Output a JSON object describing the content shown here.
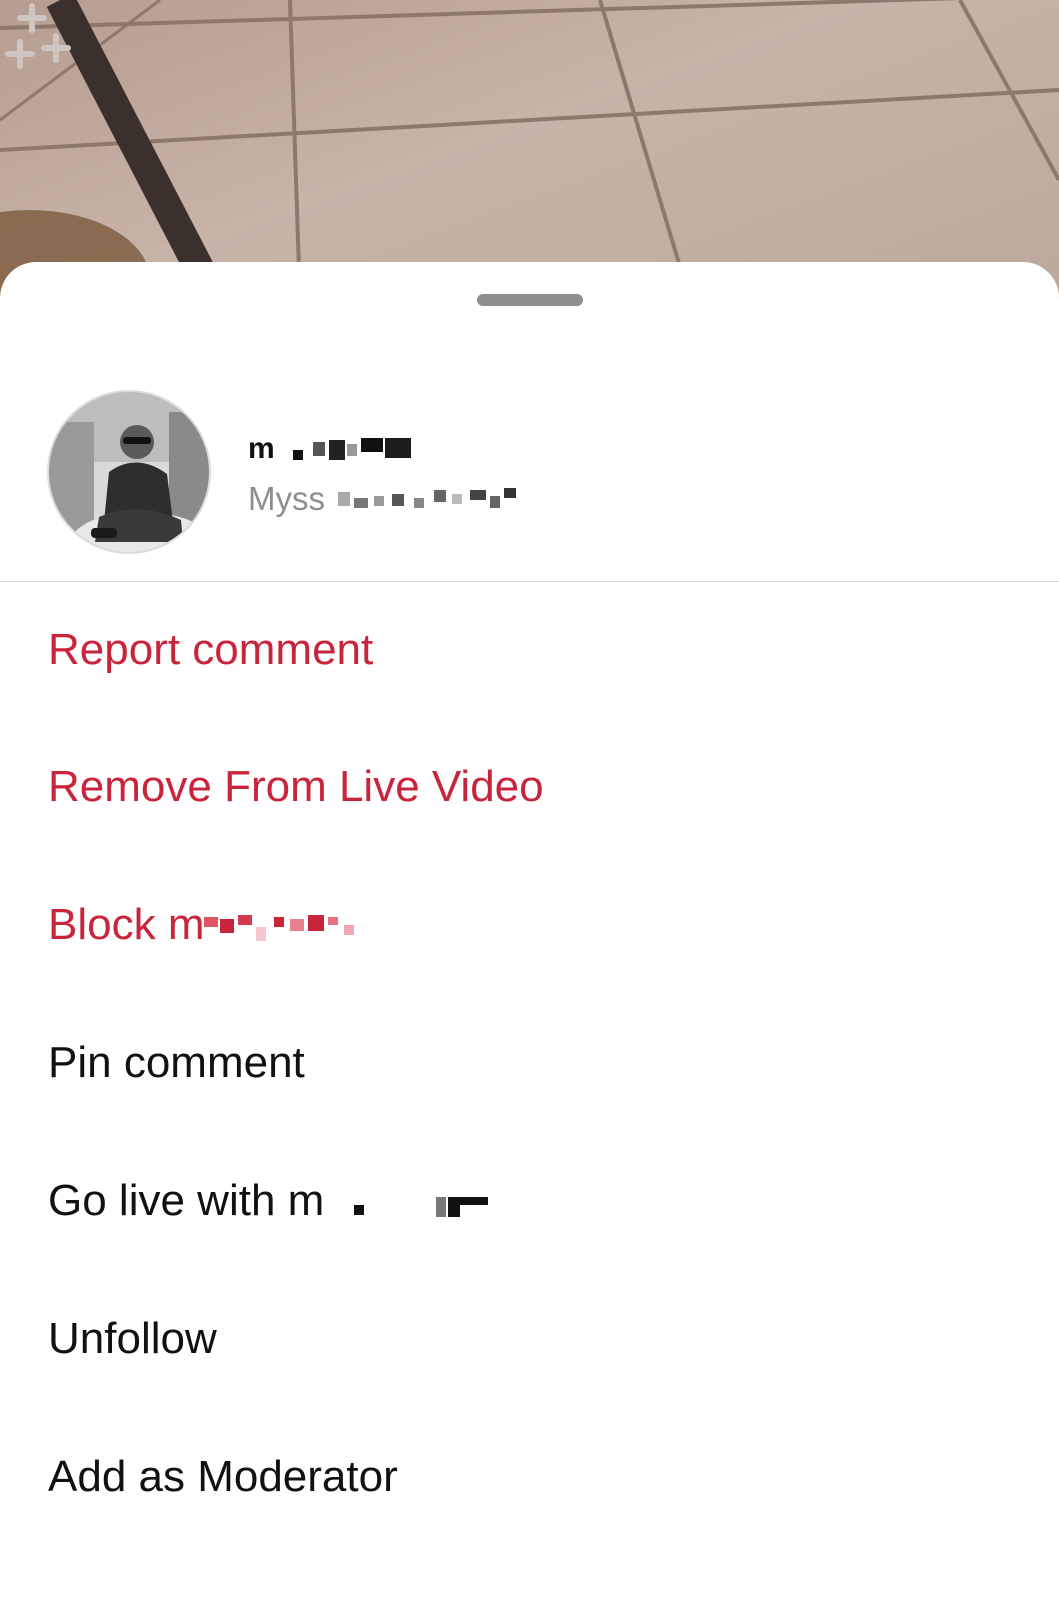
{
  "background": {
    "effects_icon": "sparkles-icon"
  },
  "sheet": {
    "profile": {
      "display_name": "m",
      "handle": "Myss"
    },
    "menu": [
      {
        "label": "Report comment",
        "color": "#c8243c"
      },
      {
        "label": "Remove From Live Video",
        "color": "#c8243c"
      },
      {
        "label": "Block m",
        "color": "#c8243c"
      },
      {
        "label": "Pin comment",
        "color": "#111111"
      },
      {
        "label": "Go live with m",
        "color": "#111111"
      },
      {
        "label": "Unfollow",
        "color": "#111111"
      },
      {
        "label": "Add as Moderator",
        "color": "#111111"
      }
    ]
  }
}
